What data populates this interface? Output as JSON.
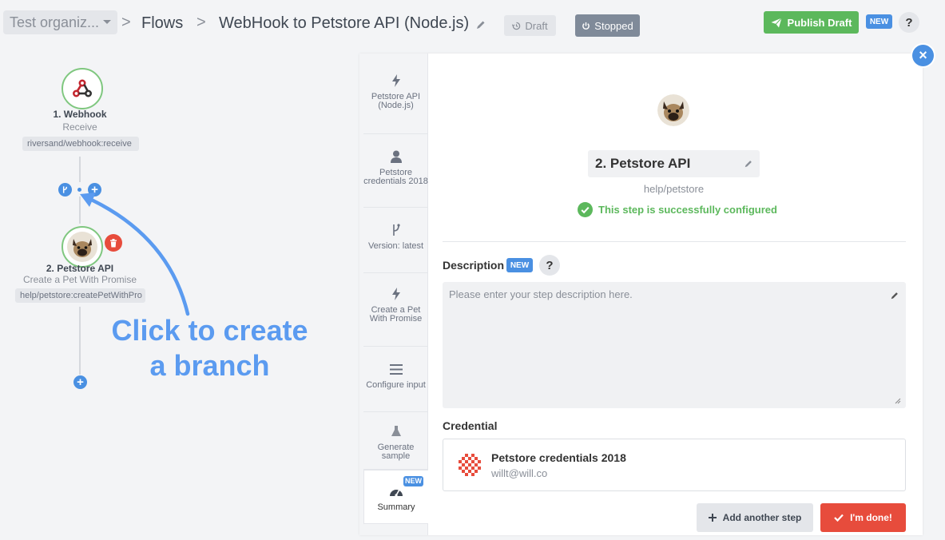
{
  "header": {
    "org_label": "Test organiz...",
    "breadcrumb_sep": ">",
    "crumb_flows": "Flows",
    "flow_title": "WebHook to Petstore API (Node.js)",
    "draft_label": "Draft",
    "stopped_label": "Stopped",
    "publish_label": "Publish Draft",
    "new_label": "NEW",
    "help_label": "?"
  },
  "flow": {
    "step1": {
      "title": "1. Webhook",
      "subtitle": "Receive",
      "path": "riversand/webhook:receive"
    },
    "step2": {
      "title": "2. Petstore API",
      "subtitle": "Create a Pet With Promise",
      "path": "help/petstore:createPetWithPro"
    },
    "add_label": "+",
    "annotation": "Click to create a branch",
    "annotation_line1": "Click to create",
    "annotation_line2": "a branch"
  },
  "panel": {
    "tabs": [
      {
        "label": "Petstore API (Node.js)",
        "icon": "bolt-icon"
      },
      {
        "label": "Petstore credentials 2018",
        "icon": "user-icon"
      },
      {
        "label": "Version: latest",
        "icon": "branch-icon"
      },
      {
        "label": "Create a Pet With Promise",
        "icon": "bolt-icon"
      },
      {
        "label": "Configure input",
        "icon": "bars-icon"
      },
      {
        "label": "Generate sample",
        "icon": "flask-icon"
      },
      {
        "label": "Summary",
        "icon": "gauge-icon",
        "badge": "NEW"
      }
    ],
    "step_name": "2. Petstore API",
    "step_ident": "help/petstore",
    "status": "This step is successfully configured",
    "description_label": "Description",
    "description_new": "NEW",
    "description_help": "?",
    "description_placeholder": "Please enter your step description here.",
    "credential_label": "Credential",
    "credential_name": "Petstore credentials 2018",
    "credential_email": "willt@will.co",
    "add_step_label": "Add another step",
    "done_label": "I'm done!",
    "close_label": "×"
  },
  "colors": {
    "accent": "#4a90e2",
    "success": "#5cb85c",
    "danger": "#e74c3c",
    "annotation": "#5b9bf0"
  }
}
